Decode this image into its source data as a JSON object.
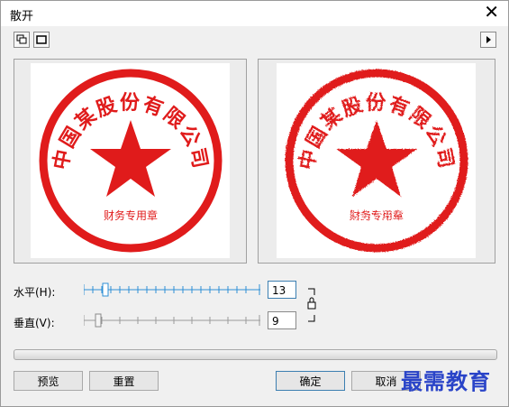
{
  "window": {
    "title": "散开"
  },
  "toolbar": {
    "icons": [
      "dual-preview-icon",
      "single-preview-icon"
    ],
    "more": "play-arrow-icon"
  },
  "preview": {
    "seal_text": "中国某股份有限公司",
    "seal_subtext": "财务专用章",
    "seal_color": "#e01b1b"
  },
  "controls": {
    "horizontal": {
      "label": "水平(H):",
      "value": "13",
      "level": 13
    },
    "vertical": {
      "label": "垂直(V):",
      "value": "9",
      "level": 9
    }
  },
  "buttons": {
    "preview": "预览",
    "reset": "重置",
    "ok": "确定",
    "cancel": "取消"
  },
  "watermark": "最需教育"
}
